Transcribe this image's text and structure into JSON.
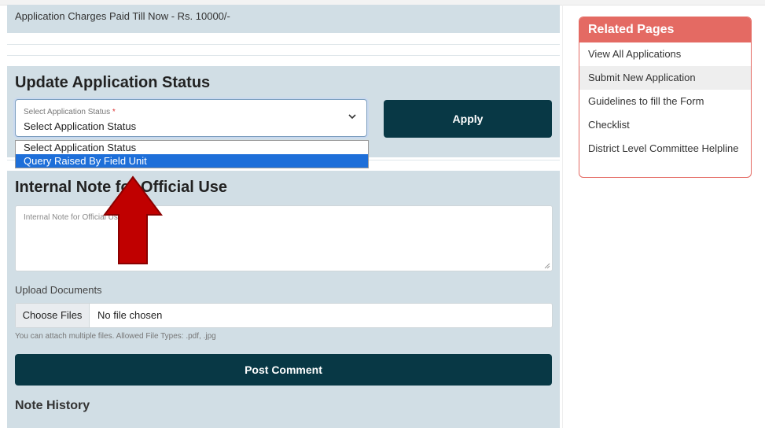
{
  "charges": {
    "text": "Application Charges Paid Till Now - Rs. 10000/-"
  },
  "status_section": {
    "title": "Update Application Status",
    "select_label": "Select Application Status",
    "required_mark": "*",
    "select_value": "Select Application Status",
    "options": [
      "Select Application Status",
      "Query Raised By Field Unit"
    ],
    "highlighted_option": "Query Raised By Field Unit",
    "apply_label": "Apply"
  },
  "note_section": {
    "title": "Internal Note for Official Use",
    "textarea_placeholder": "Internal Note for Official Use",
    "upload_label": "Upload Documents",
    "choose_files_label": "Choose Files",
    "file_status": "No file chosen",
    "help_text": "You can attach multiple files. Allowed File Types: .pdf, .jpg",
    "post_label": "Post Comment",
    "history_title": "Note History"
  },
  "related_pages": {
    "title": "Related Pages",
    "items": [
      "View All Applications",
      "Submit New Application",
      "Guidelines to fill the Form",
      "Checklist",
      "District Level Committee Helpline"
    ]
  },
  "colors": {
    "panel_bg": "#d1dee5",
    "dark_button": "#083845",
    "related_accent": "#e46a63",
    "dropdown_highlight": "#1e6fd9",
    "annotation_arrow": "#c00000"
  },
  "icons": {
    "select_chevron": "chevron-down-icon",
    "annotation": "arrow-up-icon"
  }
}
